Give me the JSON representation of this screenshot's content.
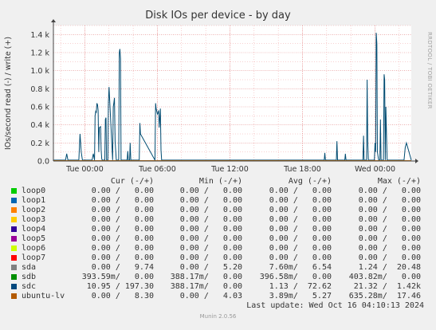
{
  "chart_data": {
    "type": "line",
    "title": "Disk IOs per device - by day",
    "ylabel": "IOs/second read (-) / write (+)",
    "side_label": "RRDTOOL / TOBI OETIKER",
    "ylim": [
      0,
      1500
    ],
    "y_ticks": [
      0,
      200,
      400,
      600,
      800,
      1000,
      1200,
      1400
    ],
    "y_tick_labels": [
      "0.0",
      "0.2 k",
      "0.4 k",
      "0.6 k",
      "0.8 k",
      "1.0 k",
      "1.2 k",
      "1.4 k"
    ],
    "xlim_hours": [
      -2.6,
      27.0
    ],
    "x_ticks_hours": [
      0,
      6,
      12,
      18,
      24
    ],
    "x_tick_labels": [
      "Tue 00:00",
      "Tue 06:00",
      "Tue 12:00",
      "Tue 18:00",
      "Wed 00:00"
    ],
    "grid": true,
    "series": [
      {
        "name": "sdc",
        "color": "#004b71",
        "x": [
          -2.6,
          -1.6,
          -1.5,
          -1.4,
          -0.5,
          -0.4,
          -0.3,
          -0.2,
          0.6,
          0.7,
          0.8,
          0.85,
          0.9,
          0.95,
          1.0,
          1.05,
          1.1,
          1.15,
          1.2,
          1.3,
          1.35,
          1.4,
          1.45,
          1.5,
          1.55,
          1.6,
          1.65,
          1.7,
          1.75,
          1.8,
          1.85,
          1.9,
          1.95,
          2.0,
          2.3,
          2.35,
          2.4,
          2.45,
          2.5,
          2.55,
          2.6,
          2.8,
          2.85,
          2.9,
          2.95,
          3.0,
          3.05,
          3.1,
          3.15,
          3.2,
          3.25,
          3.3,
          3.35,
          3.5,
          3.55,
          3.6,
          3.7,
          3.75,
          3.8,
          3.85,
          3.9,
          4.0,
          4.5,
          4.55,
          4.6,
          5.8,
          5.85,
          5.9,
          6.0,
          6.05,
          6.1,
          6.15,
          6.2,
          6.25,
          6.3,
          6.35,
          7.0,
          7.5,
          7.55,
          7.6,
          7.65,
          7.7,
          7.75,
          7.8,
          7.9,
          8.0,
          8.1,
          8.15,
          8.2,
          8.25,
          8.3,
          19.8,
          19.85,
          19.9,
          20.0,
          20.8,
          20.85,
          20.9,
          20.95,
          21.0,
          21.5,
          21.55,
          21.6,
          23.0,
          23.05,
          23.1,
          23.15,
          23.3,
          23.35,
          23.4,
          23.45,
          23.5,
          23.55,
          23.6,
          23.7,
          23.75,
          23.8,
          23.85,
          23.9,
          23.95,
          24.0,
          24.05,
          24.1,
          24.15,
          24.2,
          24.3,
          24.35,
          24.4,
          24.45,
          24.5,
          24.6,
          24.65,
          24.7,
          24.75,
          24.8,
          24.85,
          24.9,
          25.0,
          26.2,
          26.3,
          26.4,
          26.5,
          26.6,
          27.0
        ],
        "values": [
          10,
          10,
          80,
          10,
          10,
          300,
          100,
          10,
          10,
          80,
          10,
          500,
          550,
          540,
          640,
          620,
          560,
          100,
          370,
          380,
          120,
          20,
          10,
          10,
          10,
          10,
          10,
          460,
          480,
          10,
          10,
          10,
          650,
          820,
          10,
          600,
          640,
          700,
          220,
          120,
          10,
          10,
          1200,
          1240,
          1130,
          10,
          10,
          10,
          10,
          10,
          10,
          10,
          10,
          10,
          110,
          10,
          10,
          200,
          10,
          10,
          10,
          10,
          10,
          420,
          300,
          10,
          640,
          580,
          520,
          530,
          560,
          370,
          480,
          580,
          120,
          10,
          10,
          10,
          10,
          10,
          10,
          10,
          10,
          10,
          10,
          10,
          10,
          10,
          10,
          10,
          10,
          10,
          90,
          10,
          10,
          10,
          220,
          10,
          10,
          10,
          10,
          80,
          10,
          10,
          280,
          10,
          10,
          10,
          900,
          200,
          10,
          10,
          10,
          10,
          10,
          10,
          10,
          10,
          10,
          10,
          200,
          100,
          1420,
          1300,
          100,
          10,
          10,
          10,
          460,
          10,
          10,
          10,
          10,
          960,
          900,
          10,
          600,
          10,
          10,
          10,
          10,
          150,
          200,
          10
        ]
      },
      {
        "name": "sda",
        "color": "#00cc00",
        "x": [
          -2.6,
          27.0
        ],
        "values": [
          0,
          0
        ]
      },
      {
        "name": "ubuntu-lv",
        "color": "#cc7000",
        "x": [
          -2.6,
          27.0
        ],
        "values": [
          4,
          4
        ]
      }
    ]
  },
  "legend": {
    "headers": {
      "cur": "Cur (-/+)",
      "min": "Min (-/+)",
      "avg": "Avg (-/+)",
      "max": "Max (-/+)"
    },
    "rows": [
      {
        "name": "loop0",
        "color": "#00cc00",
        "cur": "0.00 /   0.00",
        "min": "0.00 /   0.00",
        "avg": "0.00 /   0.00",
        "max": "0.00 /   0.00"
      },
      {
        "name": "loop1",
        "color": "#0066b3",
        "cur": "0.00 /   0.00",
        "min": "0.00 /   0.00",
        "avg": "0.00 /   0.00",
        "max": "0.00 /   0.00"
      },
      {
        "name": "loop2",
        "color": "#ff8000",
        "cur": "0.00 /   0.00",
        "min": "0.00 /   0.00",
        "avg": "0.00 /   0.00",
        "max": "0.00 /   0.00"
      },
      {
        "name": "loop3",
        "color": "#ffcc00",
        "cur": "0.00 /   0.00",
        "min": "0.00 /   0.00",
        "avg": "0.00 /   0.00",
        "max": "0.00 /   0.00"
      },
      {
        "name": "loop4",
        "color": "#330099",
        "cur": "0.00 /   0.00",
        "min": "0.00 /   0.00",
        "avg": "0.00 /   0.00",
        "max": "0.00 /   0.00"
      },
      {
        "name": "loop5",
        "color": "#990099",
        "cur": "0.00 /   0.00",
        "min": "0.00 /   0.00",
        "avg": "0.00 /   0.00",
        "max": "0.00 /   0.00"
      },
      {
        "name": "loop6",
        "color": "#ccff00",
        "cur": "0.00 /   0.00",
        "min": "0.00 /   0.00",
        "avg": "0.00 /   0.00",
        "max": "0.00 /   0.00"
      },
      {
        "name": "loop7",
        "color": "#ff0000",
        "cur": "0.00 /   0.00",
        "min": "0.00 /   0.00",
        "avg": "0.00 /   0.00",
        "max": "0.00 /   0.00"
      },
      {
        "name": "sda",
        "color": "#808080",
        "cur": "0.00 /   9.74",
        "min": "0.00 /   5.20",
        "avg": "7.60m/   6.54",
        "max": "1.24 /  20.48"
      },
      {
        "name": "sdb",
        "color": "#008f00",
        "cur": "393.59m/   0.00",
        "min": "388.17m/   0.00",
        "avg": "396.58m/   0.00",
        "max": "403.82m/   0.00"
      },
      {
        "name": "sdc",
        "color": "#00487d",
        "cur": "10.95 / 197.30",
        "min": "388.17m/   0.00",
        "avg": "1.13 /  72.62",
        "max": "21.32 /  1.42k"
      },
      {
        "name": "ubuntu-lv",
        "color": "#b35a00",
        "cur": "0.00 /   8.30",
        "min": "0.00 /   4.03",
        "avg": "3.89m/   5.27",
        "max": "635.28m/  17.46"
      }
    ],
    "last_update": "Last update: Wed Oct 16 04:10:13 2024"
  },
  "footer": "Munin 2.0.56"
}
